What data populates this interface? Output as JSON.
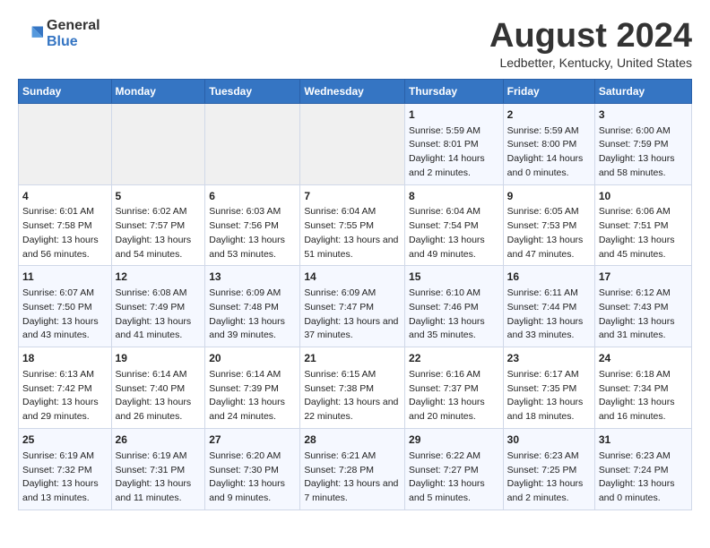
{
  "header": {
    "logo_general": "General",
    "logo_blue": "Blue",
    "main_title": "August 2024",
    "subtitle": "Ledbetter, Kentucky, United States"
  },
  "weekdays": [
    "Sunday",
    "Monday",
    "Tuesday",
    "Wednesday",
    "Thursday",
    "Friday",
    "Saturday"
  ],
  "weeks": [
    [
      {
        "day": "",
        "empty": true
      },
      {
        "day": "",
        "empty": true
      },
      {
        "day": "",
        "empty": true
      },
      {
        "day": "",
        "empty": true
      },
      {
        "day": "1",
        "sunrise": "5:59 AM",
        "sunset": "8:01 PM",
        "daylight": "14 hours and 2 minutes."
      },
      {
        "day": "2",
        "sunrise": "5:59 AM",
        "sunset": "8:00 PM",
        "daylight": "14 hours and 0 minutes."
      },
      {
        "day": "3",
        "sunrise": "6:00 AM",
        "sunset": "7:59 PM",
        "daylight": "13 hours and 58 minutes."
      }
    ],
    [
      {
        "day": "4",
        "sunrise": "6:01 AM",
        "sunset": "7:58 PM",
        "daylight": "13 hours and 56 minutes."
      },
      {
        "day": "5",
        "sunrise": "6:02 AM",
        "sunset": "7:57 PM",
        "daylight": "13 hours and 54 minutes."
      },
      {
        "day": "6",
        "sunrise": "6:03 AM",
        "sunset": "7:56 PM",
        "daylight": "13 hours and 53 minutes."
      },
      {
        "day": "7",
        "sunrise": "6:04 AM",
        "sunset": "7:55 PM",
        "daylight": "13 hours and 51 minutes."
      },
      {
        "day": "8",
        "sunrise": "6:04 AM",
        "sunset": "7:54 PM",
        "daylight": "13 hours and 49 minutes."
      },
      {
        "day": "9",
        "sunrise": "6:05 AM",
        "sunset": "7:53 PM",
        "daylight": "13 hours and 47 minutes."
      },
      {
        "day": "10",
        "sunrise": "6:06 AM",
        "sunset": "7:51 PM",
        "daylight": "13 hours and 45 minutes."
      }
    ],
    [
      {
        "day": "11",
        "sunrise": "6:07 AM",
        "sunset": "7:50 PM",
        "daylight": "13 hours and 43 minutes."
      },
      {
        "day": "12",
        "sunrise": "6:08 AM",
        "sunset": "7:49 PM",
        "daylight": "13 hours and 41 minutes."
      },
      {
        "day": "13",
        "sunrise": "6:09 AM",
        "sunset": "7:48 PM",
        "daylight": "13 hours and 39 minutes."
      },
      {
        "day": "14",
        "sunrise": "6:09 AM",
        "sunset": "7:47 PM",
        "daylight": "13 hours and 37 minutes."
      },
      {
        "day": "15",
        "sunrise": "6:10 AM",
        "sunset": "7:46 PM",
        "daylight": "13 hours and 35 minutes."
      },
      {
        "day": "16",
        "sunrise": "6:11 AM",
        "sunset": "7:44 PM",
        "daylight": "13 hours and 33 minutes."
      },
      {
        "day": "17",
        "sunrise": "6:12 AM",
        "sunset": "7:43 PM",
        "daylight": "13 hours and 31 minutes."
      }
    ],
    [
      {
        "day": "18",
        "sunrise": "6:13 AM",
        "sunset": "7:42 PM",
        "daylight": "13 hours and 29 minutes."
      },
      {
        "day": "19",
        "sunrise": "6:14 AM",
        "sunset": "7:40 PM",
        "daylight": "13 hours and 26 minutes."
      },
      {
        "day": "20",
        "sunrise": "6:14 AM",
        "sunset": "7:39 PM",
        "daylight": "13 hours and 24 minutes."
      },
      {
        "day": "21",
        "sunrise": "6:15 AM",
        "sunset": "7:38 PM",
        "daylight": "13 hours and 22 minutes."
      },
      {
        "day": "22",
        "sunrise": "6:16 AM",
        "sunset": "7:37 PM",
        "daylight": "13 hours and 20 minutes."
      },
      {
        "day": "23",
        "sunrise": "6:17 AM",
        "sunset": "7:35 PM",
        "daylight": "13 hours and 18 minutes."
      },
      {
        "day": "24",
        "sunrise": "6:18 AM",
        "sunset": "7:34 PM",
        "daylight": "13 hours and 16 minutes."
      }
    ],
    [
      {
        "day": "25",
        "sunrise": "6:19 AM",
        "sunset": "7:32 PM",
        "daylight": "13 hours and 13 minutes."
      },
      {
        "day": "26",
        "sunrise": "6:19 AM",
        "sunset": "7:31 PM",
        "daylight": "13 hours and 11 minutes."
      },
      {
        "day": "27",
        "sunrise": "6:20 AM",
        "sunset": "7:30 PM",
        "daylight": "13 hours and 9 minutes."
      },
      {
        "day": "28",
        "sunrise": "6:21 AM",
        "sunset": "7:28 PM",
        "daylight": "13 hours and 7 minutes."
      },
      {
        "day": "29",
        "sunrise": "6:22 AM",
        "sunset": "7:27 PM",
        "daylight": "13 hours and 5 minutes."
      },
      {
        "day": "30",
        "sunrise": "6:23 AM",
        "sunset": "7:25 PM",
        "daylight": "13 hours and 2 minutes."
      },
      {
        "day": "31",
        "sunrise": "6:23 AM",
        "sunset": "7:24 PM",
        "daylight": "13 hours and 0 minutes."
      }
    ]
  ],
  "labels": {
    "sunrise": "Sunrise:",
    "sunset": "Sunset:",
    "daylight": "Daylight:"
  }
}
